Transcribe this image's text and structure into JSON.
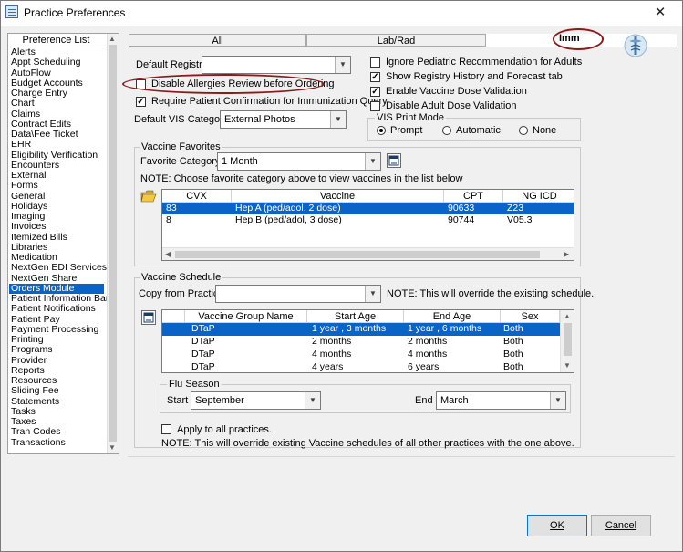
{
  "window": {
    "title": "Practice Preferences"
  },
  "preference_list": {
    "header": "Preference List",
    "items": [
      "Alerts",
      "Appt Scheduling",
      "AutoFlow",
      "Budget Accounts",
      "Charge Entry",
      "Chart",
      "Claims",
      "Contract Edits",
      "Data\\Fee Ticket",
      "EHR",
      "Eligibility Verification",
      "Encounters",
      "External",
      "Forms",
      "General",
      "Holidays",
      "Imaging",
      "Invoices",
      "Itemized Bills",
      "Libraries",
      "Medication",
      "NextGen EDI Services",
      "NextGen Share",
      "Orders Module",
      "Patient Information Bar",
      "Patient Notifications",
      "Patient Pay",
      "Payment Processing",
      "Printing",
      "Programs",
      "Provider",
      "Reports",
      "Resources",
      "Sliding Fee",
      "Statements",
      "Tasks",
      "Taxes",
      "Tran Codes",
      "Transactions"
    ],
    "selected": "Orders Module"
  },
  "tabs": [
    {
      "label": "All"
    },
    {
      "label": "Lab/Rad"
    },
    {
      "label": "Imm"
    }
  ],
  "settings": {
    "default_registry_label": "Default Registry",
    "default_registry_value": "",
    "disable_allergies_label": "Disable Allergies Review before Ordering",
    "disable_allergies_checked": false,
    "require_confirmation_label": "Require Patient Confirmation for Immunization Query",
    "require_confirmation_checked": true,
    "default_vis_label": "Default VIS Category",
    "default_vis_value": "External Photos",
    "ignore_pediatric_label": "Ignore Pediatric Recommendation for Adults",
    "ignore_pediatric_checked": false,
    "show_registry_label": "Show Registry History and Forecast tab",
    "show_registry_checked": true,
    "enable_vaccine_dose_label": "Enable Vaccine Dose Validation",
    "enable_vaccine_dose_checked": true,
    "disable_adult_dose_label": "Disable Adult Dose Validation",
    "disable_adult_dose_checked": false
  },
  "vis_print_mode": {
    "label": "VIS Print Mode",
    "options": [
      "Prompt",
      "Automatic",
      "None"
    ],
    "selected": "Prompt"
  },
  "vaccine_favorites": {
    "label": "Vaccine Favorites",
    "favorite_category_label": "Favorite Category",
    "favorite_category_value": "1 Month",
    "note": "NOTE: Choose favorite category above to view vaccines in the list below",
    "columns": [
      "CVX",
      "Vaccine",
      "CPT",
      "NG ICD"
    ],
    "rows": [
      {
        "cvx": "83",
        "vaccine": "Hep A (ped/adol, 2 dose)",
        "cpt": "90633",
        "icd": "Z23"
      },
      {
        "cvx": "8",
        "vaccine": "Hep B (ped/adol, 3 dose)",
        "cpt": "90744",
        "icd": "V05.3"
      }
    ]
  },
  "vaccine_schedule": {
    "label": "Vaccine Schedule",
    "copy_from_label": "Copy from Practice",
    "copy_from_value": "",
    "copy_note": "NOTE: This will override the existing schedule.",
    "columns": [
      "Vaccine Group Name",
      "Start Age",
      "End Age",
      "Sex"
    ],
    "rows": [
      {
        "group": "DTaP",
        "start": "1 year , 3 months",
        "end": "1 year , 6 months",
        "sex": "Both"
      },
      {
        "group": "DTaP",
        "start": "2 months",
        "end": "2 months",
        "sex": "Both"
      },
      {
        "group": "DTaP",
        "start": "4 months",
        "end": "4 months",
        "sex": "Both"
      },
      {
        "group": "DTaP",
        "start": "4 years",
        "end": "6 years",
        "sex": "Both"
      }
    ],
    "flu_season_label": "Flu Season",
    "start_label": "Start",
    "start_value": "September",
    "end_label": "End",
    "end_value": "March",
    "apply_all_label": "Apply to all practices.",
    "apply_all_checked": false,
    "apply_note": "NOTE: This will override existing Vaccine schedules of all other practices with the one above."
  },
  "buttons": {
    "ok": "OK",
    "cancel": "Cancel"
  }
}
